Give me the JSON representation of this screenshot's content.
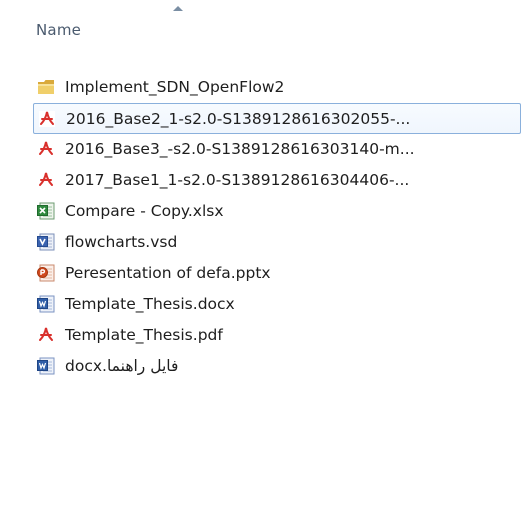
{
  "header": {
    "name_column": "Name"
  },
  "files": [
    {
      "label": "Implement_SDN_OpenFlow2",
      "icon": "folder-icon",
      "type": "folder"
    },
    {
      "label": "2016_Base2_1-s2.0-S1389128616302055-...",
      "icon": "pdf-icon",
      "type": "pdf",
      "selected": true
    },
    {
      "label": "2016_Base3_-s2.0-S1389128616303140-m...",
      "icon": "pdf-icon",
      "type": "pdf"
    },
    {
      "label": "2017_Base1_1-s2.0-S1389128616304406-...",
      "icon": "pdf-icon",
      "type": "pdf"
    },
    {
      "label": "Compare - Copy.xlsx",
      "icon": "excel-icon",
      "type": "xlsx"
    },
    {
      "label": "flowcharts.vsd",
      "icon": "visio-icon",
      "type": "vsd"
    },
    {
      "label": "Peresentation of defa.pptx",
      "icon": "powerpoint-icon",
      "type": "pptx"
    },
    {
      "label": "Template_Thesis.docx",
      "icon": "word-icon",
      "type": "docx"
    },
    {
      "label": "Template_Thesis.pdf",
      "icon": "pdf-icon",
      "type": "pdf"
    },
    {
      "label": "فایل راهنما.docx",
      "icon": "word-icon",
      "type": "docx"
    }
  ],
  "colors": {
    "selection_border": "#8ab0dc",
    "header_text": "#4a5a6e",
    "pdf_red": "#d9302c",
    "folder_yellow": "#e8c15a",
    "excel_green": "#2f8a3e",
    "word_blue": "#2f5ea8",
    "visio_blue": "#3b63b0",
    "powerpoint_red": "#d04a1f"
  }
}
